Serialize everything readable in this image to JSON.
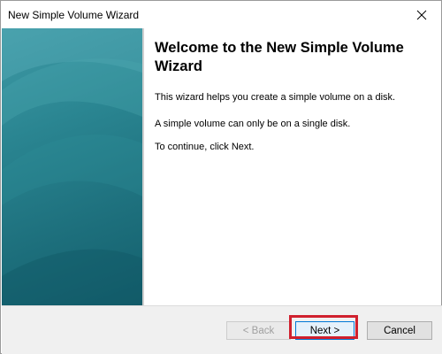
{
  "window": {
    "title": "New Simple Volume Wizard"
  },
  "content": {
    "heading": "Welcome to the New Simple Volume Wizard",
    "paragraphs": [
      "This wizard helps you create a simple volume on a disk.",
      "A simple volume can only be on a single disk.",
      "To continue, click Next."
    ]
  },
  "buttons": {
    "back": "< Back",
    "next": "Next >",
    "cancel": "Cancel"
  },
  "colors": {
    "side_panel": "#1d6f7c",
    "highlight": "#d0202e",
    "focus_border": "#0078d7"
  },
  "icons": {
    "close": "close-icon"
  }
}
